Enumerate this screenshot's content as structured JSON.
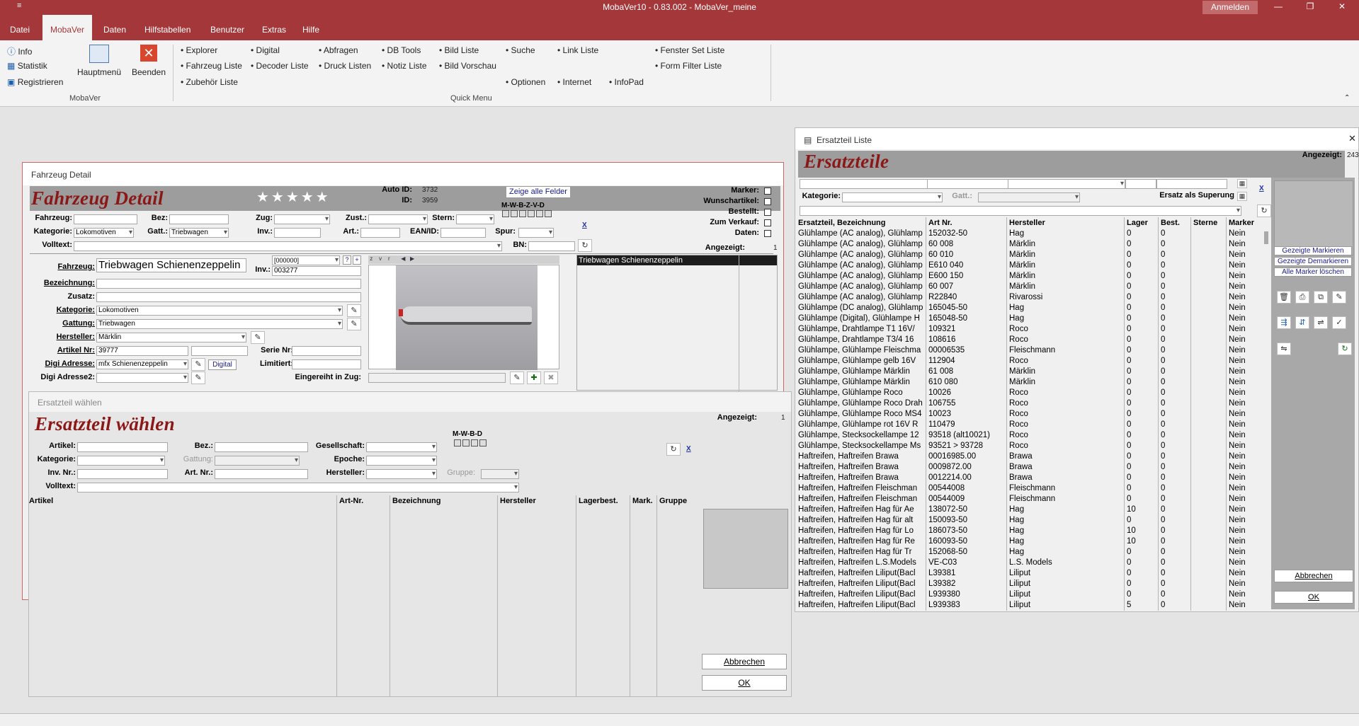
{
  "app": {
    "title": "MobaVer10 - 0.83.002 - MobaVer_meine",
    "qat": "≡",
    "signin": "Anmelden"
  },
  "menu": [
    "Datei",
    "MobaVer",
    "Daten",
    "Hilfstabellen",
    "Benutzer",
    "Extras",
    "Hilfe"
  ],
  "ribbon": {
    "group1": {
      "items": [
        "Info",
        "Statistik",
        "Registrieren"
      ],
      "big": [
        "Hauptmenü",
        "Beenden"
      ],
      "label": "MobaVer"
    },
    "quick": {
      "label": "Quick Menu",
      "items": [
        "• Explorer",
        "• Fahrzeug Liste",
        "• Zubehör Liste",
        "• Digital",
        "• Decoder Liste",
        "• Abfragen",
        "• Druck Listen",
        "• DB Tools",
        "• Notiz Liste",
        "• Bild Liste",
        "• Bild Vorschau",
        "• Suche",
        "• Optionen",
        "• Link Liste",
        "• Internet",
        "• InfoPad",
        "• Fenster Set Liste",
        "• Form Filter Liste"
      ]
    }
  },
  "fahrzeug": {
    "caption": "Fahrzeug Detail",
    "title": "Fahrzeug Detail",
    "auto_id_label": "Auto ID:",
    "auto_id": "3732",
    "id_label": "ID:",
    "id": "3959",
    "show_all": "Zeige alle Felder",
    "mwbzvd": "M-W-B-Z-V-D",
    "flags": [
      "Marker:",
      "Wunschartikel:",
      "Bestellt:",
      "Zum Verkauf:",
      "Daten:"
    ],
    "angezeigt_label": "Angezeigt:",
    "angezeigt": "1",
    "f": {
      "fahrzeug": "Fahrzeug:",
      "bez": "Bez:",
      "zug": "Zug:",
      "zust": "Zust.:",
      "stern": "Stern:",
      "kategorie": "Kategorie:",
      "kategorie_v": "Lokomotiven",
      "gatt": "Gatt.:",
      "gatt_v": "Triebwagen",
      "inv": "Inv.:",
      "art": "Art.:",
      "ean": "EAN/ID:",
      "spur": "Spur:",
      "volltext": "Volltext:",
      "bn": "BN:"
    },
    "d": {
      "fahrzeug": "Fahrzeug:",
      "fahrzeug_v": "Triebwagen Schienenzeppelin",
      "code": "[000000]",
      "inv": "Inv.:",
      "inv_v": "003277",
      "bezeichnung": "Bezeichnung:",
      "zusatz": "Zusatz:",
      "kategorie": "Kategorie:",
      "kategorie_v": "Lokomotiven",
      "gattung": "Gattung:",
      "gattung_v": "Triebwagen",
      "hersteller": "Hersteller:",
      "hersteller_v": "Märklin",
      "artikel": "Artikel Nr:",
      "artikel_v": "39777",
      "serie": "Serie Nr:",
      "digi": "Digi Adresse:",
      "digi_v": "mfx Schienenzeppelin",
      "digital": "Digital",
      "limitiert": "Limitiert:",
      "digi2": "Digi Adresse2:",
      "eingereiht": "Eingereiht in Zug:"
    },
    "list_item": "Triebwagen Schienenzeppelin",
    "xbtn": "X",
    "qbtn": "?",
    "plus": "+"
  },
  "ersatzwahl": {
    "caption": "Ersatzteil wählen",
    "title": "Ersatzteil wählen",
    "mwbd": "M-W-B-D",
    "angezeigt_label": "Angezeigt:",
    "angezeigt": "1",
    "f": {
      "artikel": "Artikel:",
      "bez": "Bez.:",
      "gesellschaft": "Gesellschaft:",
      "kategorie": "Kategorie:",
      "gattung": "Gattung:",
      "epoche": "Epoche:",
      "inv": "Inv. Nr.:",
      "artnr": "Art. Nr.:",
      "hersteller": "Hersteller:",
      "gruppe": "Gruppe:",
      "volltext": "Volltext:"
    },
    "cols": [
      "Artikel",
      "Art-Nr.",
      "Bezeichnung",
      "Hersteller",
      "Lagerbest.",
      "Mark.",
      "Gruppe"
    ],
    "cancel": "Abbrechen",
    "ok": "OK",
    "xbtn": "X"
  },
  "ersatzliste": {
    "caption": "Ersatzteil Liste",
    "title": "Ersatzteile",
    "angezeigt_label": "Angezeigt:",
    "angezeigt": "243",
    "kategorie": "Kategorie:",
    "gatt": "Gatt.:",
    "superung": "Ersatz als Superung",
    "cols": [
      "Ersatzteil, Bezeichnung",
      "Art Nr.",
      "Hersteller",
      "Lager",
      "Best.",
      "Sterne",
      "Marker"
    ],
    "side": [
      "Gezeigte Markieren",
      "Gezeigte Demarkieren",
      "Alle Marker löschen"
    ],
    "cancel": "Abbrechen",
    "ok": "OK",
    "close": "✕",
    "xbtn": "X",
    "rows": [
      [
        "Glühlampe (AC analog), Glühlamp",
        "152032-50",
        "Hag",
        "0",
        "0",
        "",
        "Nein"
      ],
      [
        "Glühlampe (AC analog), Glühlamp",
        "60 008",
        "Märklin",
        "0",
        "0",
        "",
        "Nein"
      ],
      [
        "Glühlampe (AC analog), Glühlamp",
        "60 010",
        "Märklin",
        "0",
        "0",
        "",
        "Nein"
      ],
      [
        "Glühlampe (AC analog), Glühlamp",
        "E610 040",
        "Märklin",
        "0",
        "0",
        "",
        "Nein"
      ],
      [
        "Glühlampe (AC analog), Glühlamp",
        "E600 150",
        "Märklin",
        "0",
        "0",
        "",
        "Nein"
      ],
      [
        "Glühlampe (AC analog), Glühlamp",
        "60 007",
        "Märklin",
        "0",
        "0",
        "",
        "Nein"
      ],
      [
        "Glühlampe (AC analog), Glühlamp",
        "R22840",
        "Rivarossi",
        "0",
        "0",
        "",
        "Nein"
      ],
      [
        "Glühlampe (DC analog), Glühlamp",
        "165045-50",
        "Hag",
        "0",
        "0",
        "",
        "Nein"
      ],
      [
        "Glühlampe (Digital), Glühlampe H",
        "165048-50",
        "Hag",
        "0",
        "0",
        "",
        "Nein"
      ],
      [
        "Glühlampe, Drahtlampe T1 16V/",
        "109321",
        "Roco",
        "0",
        "0",
        "",
        "Nein"
      ],
      [
        "Glühlampe, Drahtlampe T3/4 16",
        "108616",
        "Roco",
        "0",
        "0",
        "",
        "Nein"
      ],
      [
        "Glühlampe, Glühlampe Fleischma",
        "00006535",
        "Fleischmann",
        "0",
        "0",
        "",
        "Nein"
      ],
      [
        "Glühlampe, Glühlampe gelb 16V",
        "112904",
        "Roco",
        "0",
        "0",
        "",
        "Nein"
      ],
      [
        "Glühlampe, Glühlampe Märklin",
        "61 008",
        "Märklin",
        "0",
        "0",
        "",
        "Nein"
      ],
      [
        "Glühlampe, Glühlampe Märklin",
        "610 080",
        "Märklin",
        "0",
        "0",
        "",
        "Nein"
      ],
      [
        "Glühlampe, Glühlampe Roco",
        "10026",
        "Roco",
        "0",
        "0",
        "",
        "Nein"
      ],
      [
        "Glühlampe, Glühlampe Roco Drah",
        "106755",
        "Roco",
        "0",
        "0",
        "",
        "Nein"
      ],
      [
        "Glühlampe, Glühlampe Roco MS4",
        "10023",
        "Roco",
        "0",
        "0",
        "",
        "Nein"
      ],
      [
        "Glühlampe, Glühlampe rot 16V R",
        "110479",
        "Roco",
        "0",
        "0",
        "",
        "Nein"
      ],
      [
        "Glühlampe, Stecksockellampe 12",
        "93518 (alt10021)",
        "Roco",
        "0",
        "0",
        "",
        "Nein"
      ],
      [
        "Glühlampe, Stecksockellampe Ms",
        "93521 > 93728",
        "Roco",
        "0",
        "0",
        "",
        "Nein"
      ],
      [
        "Haftreifen, Haftreifen Brawa",
        "00016985.00",
        "Brawa",
        "0",
        "0",
        "",
        "Nein"
      ],
      [
        "Haftreifen, Haftreifen Brawa",
        "0009872.00",
        "Brawa",
        "0",
        "0",
        "",
        "Nein"
      ],
      [
        "Haftreifen, Haftreifen Brawa",
        "0012214.00",
        "Brawa",
        "0",
        "0",
        "",
        "Nein"
      ],
      [
        "Haftreifen, Haftreifen Fleischman",
        "00544008",
        "Fleischmann",
        "0",
        "0",
        "",
        "Nein"
      ],
      [
        "Haftreifen, Haftreifen Fleischman",
        "00544009",
        "Fleischmann",
        "0",
        "0",
        "",
        "Nein"
      ],
      [
        "Haftreifen, Haftreifen Hag für Ae",
        "138072-50",
        "Hag",
        "10",
        "0",
        "",
        "Nein"
      ],
      [
        "Haftreifen, Haftreifen Hag für alt",
        "150093-50",
        "Hag",
        "0",
        "0",
        "",
        "Nein"
      ],
      [
        "Haftreifen, Haftreifen Hag für Lo",
        "186073-50",
        "Hag",
        "10",
        "0",
        "",
        "Nein"
      ],
      [
        "Haftreifen, Haftreifen Hag für Re",
        "160093-50",
        "Hag",
        "10",
        "0",
        "",
        "Nein"
      ],
      [
        "Haftreifen, Haftreifen Hag für Tr",
        "152068-50",
        "Hag",
        "0",
        "0",
        "",
        "Nein"
      ],
      [
        "Haftreifen, Haftreifen L.S.Models",
        "VE-C03",
        "L.S. Models",
        "0",
        "0",
        "",
        "Nein"
      ],
      [
        "Haftreifen, Haftreifen Liliput(Bacl",
        "L39381",
        "Liliput",
        "0",
        "0",
        "",
        "Nein"
      ],
      [
        "Haftreifen, Haftreifen Liliput(Bacl",
        "L39382",
        "Liliput",
        "0",
        "0",
        "",
        "Nein"
      ],
      [
        "Haftreifen, Haftreifen Liliput(Bacl",
        "L939380",
        "Liliput",
        "0",
        "0",
        "",
        "Nein"
      ],
      [
        "Haftreifen, Haftreifen Liliput(Bacl",
        "L939383",
        "Liliput",
        "5",
        "0",
        "",
        "Nein"
      ]
    ]
  },
  "colors": {
    "accent": "#a4373a",
    "title_red": "#8b1717",
    "band": "#9d9d9d"
  }
}
